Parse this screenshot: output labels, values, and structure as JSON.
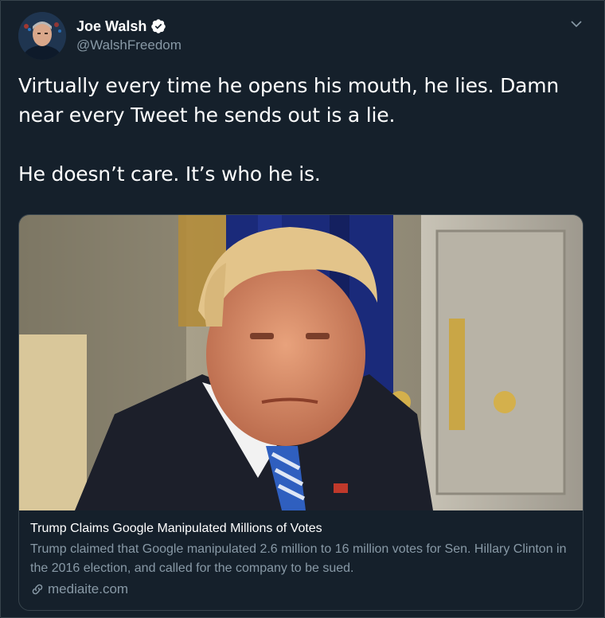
{
  "author": {
    "display_name": "Joe Walsh",
    "handle": "@WalshFreedom",
    "verified": true,
    "avatar_icon": "avatar-photo"
  },
  "tweet": {
    "paragraphs": [
      "Virtually every time he opens his mouth, he lies. Damn near every Tweet he sends out is a lie.",
      "He doesn’t care. It’s who he is."
    ]
  },
  "card": {
    "title": "Trump Claims Google Manipulated Millions of Votes",
    "description": "Trump claimed that Google manipulated 2.6 million to 16 million votes for Sen. Hillary Clinton in the 2016 election, and called for the company to be sued.",
    "domain": "mediaite.com",
    "link_icon": "link-icon",
    "image_icon": "news-photo"
  },
  "colors": {
    "background": "#15202b",
    "border": "#38444d",
    "text_primary": "#ffffff",
    "text_secondary": "#8899a6",
    "verified_badge": "#ffffff"
  },
  "menu": {
    "icon": "chevron-down-icon"
  }
}
